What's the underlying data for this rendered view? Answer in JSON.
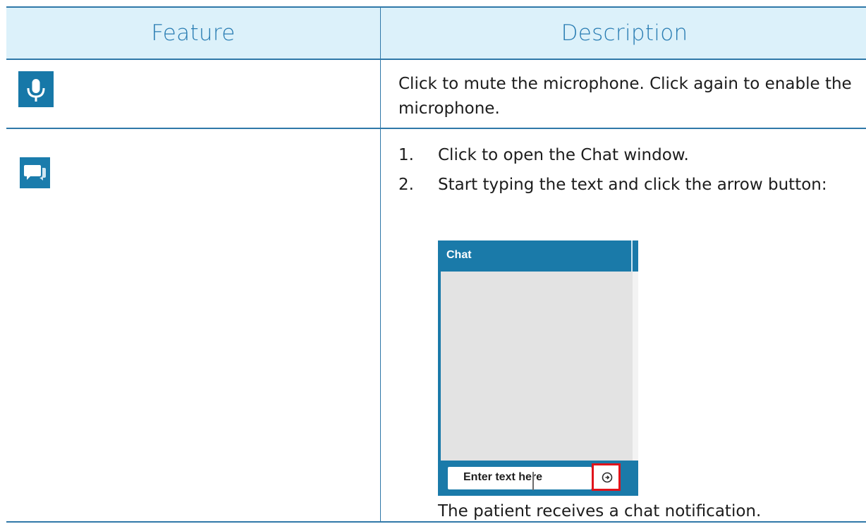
{
  "table": {
    "header": {
      "feature": "Feature",
      "description": "Description"
    },
    "rows": [
      {
        "icon": "microphone-icon",
        "description": "Click to mute the microphone. Click again to enable the microphone."
      },
      {
        "icon": "chat-bubbles-icon",
        "steps": [
          {
            "num": "1.",
            "text": "Click to open the Chat window."
          },
          {
            "num": "2.",
            "text": "Start typing the text and click the arrow button:"
          }
        ],
        "chat_window": {
          "title": "Chat",
          "input_value": "Enter text here",
          "send_icon": "arrow-circle-icon"
        },
        "footer": "The patient receives a chat notification."
      }
    ]
  },
  "colors": {
    "accent": "#2a7db3",
    "header_bg": "#dcf1fa",
    "icon_bg": "#1778a8",
    "highlight": "#e0141b"
  }
}
